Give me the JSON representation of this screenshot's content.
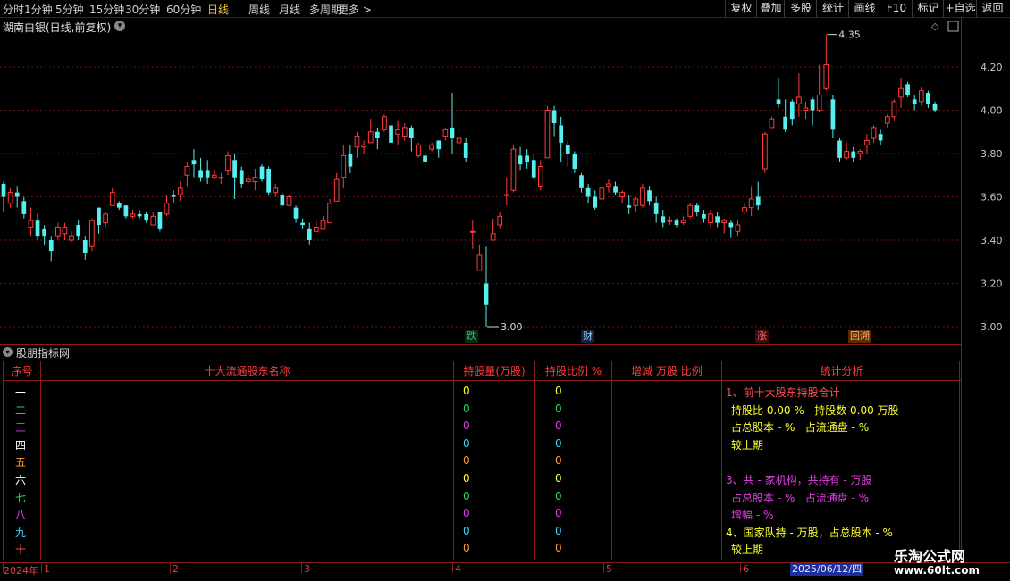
{
  "toolbar": {
    "left_items": [
      "分时",
      "1分钟",
      "5分钟",
      "15分钟",
      "30分钟",
      "60分钟",
      "日线",
      "周线",
      "月线",
      "多周期",
      "更多 >"
    ],
    "active": "日线",
    "right_items": [
      "复权",
      "叠加",
      "多股",
      "统计",
      "画线",
      "F10",
      "标记",
      "+自选",
      "返回"
    ]
  },
  "chart": {
    "title": "湖南白银(日线,前复权)",
    "high_label": "4.35",
    "low_label": "3.00",
    "price_ticks": [
      "4.20",
      "4.00",
      "3.80",
      "3.60",
      "3.40",
      "3.20",
      "3.00"
    ],
    "signals": [
      {
        "text": "跌",
        "color": "#29c26a",
        "bg": "#0c2a12"
      },
      {
        "text": "财",
        "color": "#9fd6ff",
        "bg": "#0d2040"
      },
      {
        "text": "涨",
        "color": "#ff6060",
        "bg": "#3a0c0c"
      },
      {
        "text": "回溯",
        "color": "#ffb070",
        "bg": "#5a2a00"
      }
    ],
    "colors": {
      "up": "#ff3b3b",
      "down": "#54f0f0",
      "grid": "#6a1414"
    }
  },
  "chart_data": {
    "type": "candlestick",
    "title": "湖南白银(日线,前复权)",
    "y_ticks": [
      3.0,
      3.2,
      3.4,
      3.6,
      3.8,
      4.0,
      4.2
    ],
    "ylim": [
      2.95,
      4.4
    ],
    "annotations": {
      "high": 4.35,
      "low": 3.0
    },
    "x_ticks": [
      "2024年",
      "1",
      "2",
      "3",
      "4",
      "5",
      "6",
      "2025/06/12/四"
    ],
    "candles": [
      [
        3.66,
        3.6,
        3.67,
        3.53
      ],
      [
        3.57,
        3.62,
        3.64,
        3.55
      ],
      [
        3.62,
        3.6,
        3.65,
        3.55
      ],
      [
        3.58,
        3.52,
        3.6,
        3.5
      ],
      [
        3.46,
        3.49,
        3.55,
        3.42
      ],
      [
        3.49,
        3.42,
        3.52,
        3.4
      ],
      [
        3.45,
        3.42,
        3.47,
        3.38
      ],
      [
        3.4,
        3.35,
        3.42,
        3.3
      ],
      [
        3.42,
        3.46,
        3.48,
        3.4
      ],
      [
        3.43,
        3.46,
        3.48,
        3.4
      ],
      [
        3.4,
        3.42,
        3.44,
        3.39
      ],
      [
        3.47,
        3.42,
        3.49,
        3.4
      ],
      [
        3.4,
        3.34,
        3.42,
        3.31
      ],
      [
        3.37,
        3.49,
        3.5,
        3.35
      ],
      [
        3.55,
        3.47,
        3.55,
        3.43
      ],
      [
        3.48,
        3.52,
        3.53,
        3.46
      ],
      [
        3.56,
        3.62,
        3.64,
        3.56
      ],
      [
        3.57,
        3.55,
        3.58,
        3.54
      ],
      [
        3.56,
        3.51,
        3.56,
        3.5
      ],
      [
        3.51,
        3.52,
        3.54,
        3.5
      ],
      [
        3.52,
        3.51,
        3.54,
        3.5
      ],
      [
        3.52,
        3.49,
        3.53,
        3.48
      ],
      [
        3.47,
        3.51,
        3.53,
        3.47
      ],
      [
        3.53,
        3.45,
        3.53,
        3.44
      ],
      [
        3.52,
        3.57,
        3.61,
        3.51
      ],
      [
        3.61,
        3.6,
        3.63,
        3.57
      ],
      [
        3.61,
        3.64,
        3.67,
        3.58
      ],
      [
        3.7,
        3.74,
        3.76,
        3.65
      ],
      [
        3.77,
        3.75,
        3.82,
        3.69
      ],
      [
        3.72,
        3.69,
        3.78,
        3.67
      ],
      [
        3.72,
        3.69,
        3.77,
        3.66
      ],
      [
        3.69,
        3.7,
        3.72,
        3.68
      ],
      [
        3.69,
        3.69,
        3.71,
        3.66
      ],
      [
        3.72,
        3.79,
        3.81,
        3.7
      ],
      [
        3.77,
        3.69,
        3.8,
        3.59
      ],
      [
        3.72,
        3.66,
        3.74,
        3.64
      ],
      [
        3.67,
        3.68,
        3.7,
        3.66
      ],
      [
        3.67,
        3.69,
        3.73,
        3.63
      ],
      [
        3.74,
        3.68,
        3.75,
        3.67
      ],
      [
        3.73,
        3.62,
        3.74,
        3.61
      ],
      [
        3.62,
        3.64,
        3.66,
        3.6
      ],
      [
        3.61,
        3.56,
        3.62,
        3.56
      ],
      [
        3.56,
        3.6,
        3.61,
        3.56
      ],
      [
        3.55,
        3.5,
        3.56,
        3.48
      ],
      [
        3.48,
        3.47,
        3.5,
        3.45
      ],
      [
        3.45,
        3.4,
        3.48,
        3.38
      ],
      [
        3.44,
        3.46,
        3.49,
        3.44
      ],
      [
        3.45,
        3.49,
        3.51,
        3.45
      ],
      [
        3.48,
        3.57,
        3.59,
        3.48
      ],
      [
        3.58,
        3.68,
        3.71,
        3.58
      ],
      [
        3.69,
        3.79,
        3.84,
        3.64
      ],
      [
        3.8,
        3.74,
        3.84,
        3.71
      ],
      [
        3.83,
        3.88,
        3.9,
        3.78
      ],
      [
        3.83,
        3.84,
        3.86,
        3.8
      ],
      [
        3.85,
        3.9,
        3.96,
        3.85
      ],
      [
        3.9,
        3.87,
        3.92,
        3.82
      ],
      [
        3.91,
        3.97,
        3.98,
        3.9
      ],
      [
        3.93,
        3.85,
        3.95,
        3.84
      ],
      [
        3.89,
        3.91,
        3.95,
        3.84
      ],
      [
        3.88,
        3.92,
        3.94,
        3.86
      ],
      [
        3.92,
        3.87,
        3.93,
        3.81
      ],
      [
        3.79,
        3.84,
        3.85,
        3.78
      ],
      [
        3.79,
        3.76,
        3.82,
        3.73
      ],
      [
        3.82,
        3.84,
        3.85,
        3.81
      ],
      [
        3.86,
        3.82,
        3.86,
        3.78
      ],
      [
        3.88,
        3.91,
        3.92,
        3.86
      ],
      [
        3.92,
        3.87,
        4.08,
        3.8
      ],
      [
        3.85,
        3.87,
        3.89,
        3.78
      ],
      [
        3.85,
        3.78,
        3.87,
        3.76
      ],
      [
        3.44,
        3.44,
        3.49,
        3.36
      ],
      [
        3.26,
        3.33,
        3.38,
        3.26
      ],
      [
        3.2,
        3.1,
        3.37,
        3.0
      ],
      [
        3.4,
        3.43,
        3.5,
        3.4
      ],
      [
        3.47,
        3.51,
        3.53,
        3.45
      ],
      [
        3.61,
        3.61,
        3.69,
        3.56
      ],
      [
        3.63,
        3.82,
        3.84,
        3.62
      ],
      [
        3.79,
        3.75,
        3.83,
        3.72
      ],
      [
        3.79,
        3.76,
        3.82,
        3.73
      ],
      [
        3.77,
        3.69,
        3.8,
        3.68
      ],
      [
        3.65,
        3.74,
        3.77,
        3.63
      ],
      [
        3.78,
        4.0,
        4.02,
        3.79
      ],
      [
        4.0,
        3.94,
        4.02,
        3.88
      ],
      [
        3.93,
        3.85,
        3.97,
        3.76
      ],
      [
        3.84,
        3.8,
        3.86,
        3.74
      ],
      [
        3.8,
        3.73,
        3.81,
        3.71
      ],
      [
        3.7,
        3.64,
        3.71,
        3.62
      ],
      [
        3.64,
        3.6,
        3.66,
        3.57
      ],
      [
        3.6,
        3.55,
        3.63,
        3.54
      ],
      [
        3.59,
        3.64,
        3.65,
        3.58
      ],
      [
        3.65,
        3.66,
        3.68,
        3.62
      ],
      [
        3.65,
        3.62,
        3.67,
        3.61
      ],
      [
        3.6,
        3.62,
        3.63,
        3.57
      ],
      [
        3.56,
        3.55,
        3.61,
        3.52
      ],
      [
        3.56,
        3.59,
        3.6,
        3.53
      ],
      [
        3.56,
        3.64,
        3.66,
        3.55
      ],
      [
        3.63,
        3.58,
        3.65,
        3.56
      ],
      [
        3.57,
        3.52,
        3.6,
        3.48
      ],
      [
        3.51,
        3.48,
        3.54,
        3.46
      ],
      [
        3.49,
        3.49,
        3.51,
        3.47
      ],
      [
        3.49,
        3.47,
        3.5,
        3.46
      ],
      [
        3.48,
        3.49,
        3.51,
        3.47
      ],
      [
        3.51,
        3.56,
        3.57,
        3.5
      ],
      [
        3.56,
        3.53,
        3.57,
        3.51
      ],
      [
        3.52,
        3.5,
        3.54,
        3.48
      ],
      [
        3.48,
        3.52,
        3.54,
        3.46
      ],
      [
        3.51,
        3.48,
        3.53,
        3.46
      ],
      [
        3.48,
        3.49,
        3.5,
        3.43
      ],
      [
        3.48,
        3.46,
        3.49,
        3.41
      ],
      [
        3.44,
        3.47,
        3.49,
        3.42
      ],
      [
        3.53,
        3.55,
        3.57,
        3.52
      ],
      [
        3.55,
        3.59,
        3.65,
        3.51
      ],
      [
        3.6,
        3.56,
        3.67,
        3.54
      ],
      [
        3.73,
        3.89,
        3.9,
        3.71
      ],
      [
        3.92,
        3.96,
        3.97,
        3.92
      ],
      [
        4.05,
        4.03,
        4.15,
        4.01
      ],
      [
        3.97,
        3.91,
        4.05,
        3.9
      ],
      [
        4.04,
        3.96,
        4.05,
        3.93
      ],
      [
        4.03,
        4.06,
        4.17,
        3.97
      ],
      [
        4.0,
        4.01,
        4.04,
        3.96
      ],
      [
        4.05,
        4.0,
        4.06,
        3.93
      ],
      [
        4.0,
        4.07,
        4.21,
        3.99
      ],
      [
        4.1,
        4.21,
        4.35,
        4.09
      ],
      [
        4.05,
        3.91,
        4.07,
        3.87
      ],
      [
        3.86,
        3.78,
        3.87,
        3.76
      ],
      [
        3.78,
        3.81,
        3.85,
        3.77
      ],
      [
        3.81,
        3.78,
        3.83,
        3.76
      ],
      [
        3.8,
        3.81,
        3.82,
        3.77
      ],
      [
        3.84,
        3.86,
        3.89,
        3.8
      ],
      [
        3.87,
        3.92,
        3.93,
        3.85
      ],
      [
        3.89,
        3.86,
        3.91,
        3.84
      ],
      [
        3.94,
        3.97,
        3.98,
        3.92
      ],
      [
        3.97,
        4.04,
        4.05,
        3.95
      ],
      [
        4.06,
        4.1,
        4.15,
        4.01
      ],
      [
        4.12,
        4.07,
        4.13,
        4.06
      ],
      [
        4.05,
        4.03,
        4.07,
        4.0
      ],
      [
        4.04,
        4.09,
        4.11,
        4.02
      ],
      [
        4.08,
        4.03,
        4.09,
        4.01
      ],
      [
        4.03,
        4.0,
        4.04,
        3.99
      ]
    ]
  },
  "panel2": {
    "title": "股朋指标网",
    "headers": [
      "序号",
      "十大流通股东名称",
      "持股量(万股)",
      "持股比例 %",
      "增减 万股 比例",
      "统计分析"
    ],
    "rows": [
      {
        "seq": "一",
        "color": "#ffffff",
        "qty": "0",
        "pct": "0",
        "qcolor": "#ffff30"
      },
      {
        "seq": "二",
        "color": "#30d060",
        "qty": "0",
        "pct": "0",
        "qcolor": "#30d060"
      },
      {
        "seq": "三",
        "color": "#e040e0",
        "qty": "0",
        "pct": "0",
        "qcolor": "#e040e0"
      },
      {
        "seq": "四",
        "color": "#ffffff",
        "qty": "0",
        "pct": "0",
        "qcolor": "#40d0f0"
      },
      {
        "seq": "五",
        "color": "#ff9a30",
        "qty": "0",
        "pct": "0",
        "qcolor": "#ff9a30"
      },
      {
        "seq": "六",
        "color": "#ffffff",
        "qty": "0",
        "pct": "0",
        "qcolor": "#ffff30"
      },
      {
        "seq": "七",
        "color": "#30d060",
        "qty": "0",
        "pct": "0",
        "qcolor": "#30d060"
      },
      {
        "seq": "八",
        "color": "#e040e0",
        "qty": "0",
        "pct": "0",
        "qcolor": "#e040e0"
      },
      {
        "seq": "九",
        "color": "#40d0f0",
        "qty": "0",
        "pct": "0",
        "qcolor": "#40d0f0"
      },
      {
        "seq": "十",
        "color": "#ff6060",
        "qty": "0",
        "pct": "0",
        "qcolor": "#ff9a30"
      }
    ],
    "analysis": [
      {
        "text": "1、前十大股东持股合计",
        "color": "#ff5050"
      },
      {
        "text": "持股比 0.00 %   持股数 0.00 万股",
        "color": "#ffff30"
      },
      {
        "text": "占总股本 - %   占流通盘 - %",
        "color": "#ffff30"
      },
      {
        "text": "较上期",
        "color": "#ffff30"
      },
      {
        "text": "",
        "color": "#ffffff"
      },
      {
        "text": "3、共 - 家机构，共持有 - 万股",
        "color": "#e040e0"
      },
      {
        "text": "占总股本 - %   占流通盘 - %",
        "color": "#e040e0"
      },
      {
        "text": "增幅 - %",
        "color": "#e040e0"
      },
      {
        "text": "4、国家队持 - 万股，占总股本 - %",
        "color": "#ffff30"
      },
      {
        "text": "较上期",
        "color": "#ffff30"
      }
    ]
  },
  "timeline": {
    "labels": [
      "2024年",
      "1",
      "2",
      "3",
      "4",
      "5",
      "6"
    ],
    "current_date": "2025/06/12/四"
  },
  "watermark": {
    "line1": "乐淘公式网",
    "line2": "www.60lt.com"
  }
}
